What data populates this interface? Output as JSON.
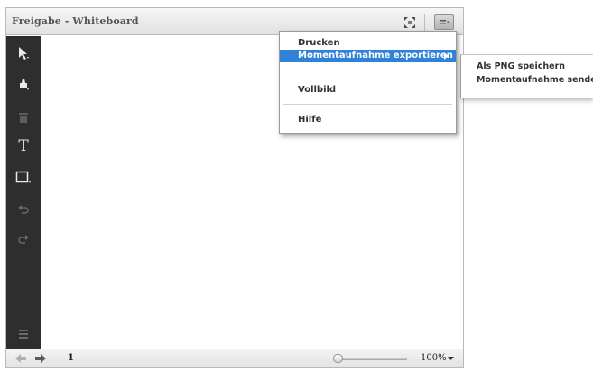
{
  "pod": {
    "title": "Freigabe - Whiteboard"
  },
  "toolbar": {
    "tools": [
      {
        "name": "selection-tool",
        "icon": "arrow-pointer-icon"
      },
      {
        "name": "marker-tool",
        "icon": "marker-icon"
      },
      {
        "name": "delete-tool",
        "icon": "trash-icon"
      },
      {
        "name": "text-tool",
        "icon": "text-icon",
        "glyph": "T"
      },
      {
        "name": "shape-tool",
        "icon": "rectangle-icon"
      },
      {
        "name": "undo-tool",
        "icon": "undo-icon"
      },
      {
        "name": "redo-tool",
        "icon": "redo-icon"
      },
      {
        "name": "properties-tool",
        "icon": "layers-icon"
      }
    ]
  },
  "menu": {
    "items": [
      {
        "label": "Drucken"
      },
      {
        "label": "Momentaufnahme exportieren",
        "active": true,
        "has_submenu": true
      },
      {
        "label": "Vollbild"
      },
      {
        "label": "Hilfe"
      }
    ],
    "submenu": {
      "items": [
        {
          "label": "Als PNG speichern"
        },
        {
          "label": "Momentaufnahme senden"
        }
      ]
    }
  },
  "statusbar": {
    "page": "1",
    "zoom": "100%"
  },
  "colors": {
    "toolbar_bg": "#2e2e2e",
    "menu_highlight": "#2f82d6"
  }
}
